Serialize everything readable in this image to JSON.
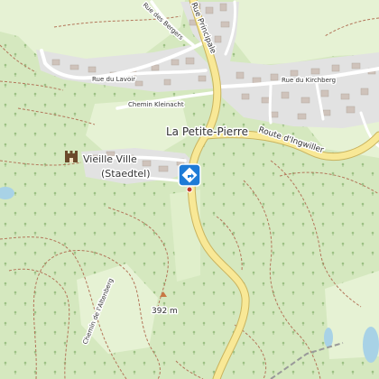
{
  "map": {
    "town_name": "La Petite-Pierre",
    "old_town_line1": "Vieille Ville",
    "old_town_line2": "(Staedtel)",
    "elevation": "392 m",
    "roads": {
      "rue_principale": "Rue Principale",
      "rue_des_bergers": "Rue des Bergers",
      "rue_du_lavoir": "Rue du Lavoir",
      "chemin_kleinacht": "Chemin Kleinacht",
      "rue_du_kirchberg": "Rue du Kirchberg",
      "route_ingwiller": "Route d'Ingwiller",
      "chemin_altenberg": "Chemin de l'Altenberg"
    },
    "icons": {
      "castle": "castle-icon",
      "direction": "direction-sign-icon",
      "peak": "peak-icon",
      "trees": "tree-icon"
    },
    "colors": {
      "forest": "#d5e8bf",
      "meadow": "#e6f2d4",
      "residential": "#e2e2e2",
      "main_road": "#f8e896",
      "main_road_casing": "#c9b35e",
      "path": "#b3765a",
      "water": "#a8d2e6",
      "marker": "#1e7bd6"
    }
  }
}
